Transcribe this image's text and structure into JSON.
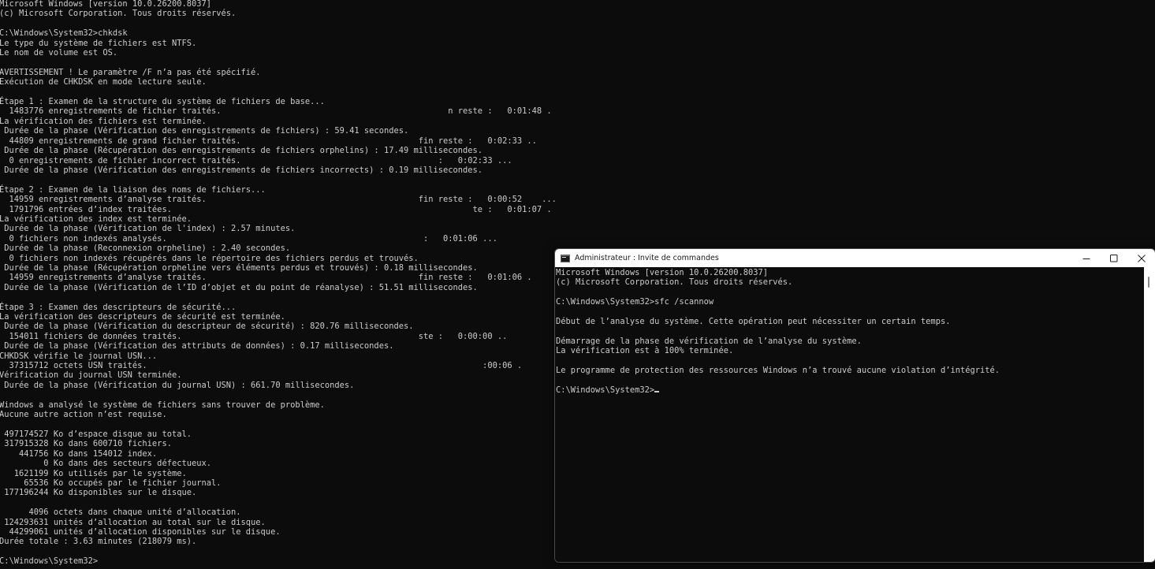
{
  "background_console": {
    "lines": [
      "Microsoft Windows [version 10.0.26200.8037]",
      "(c) Microsoft Corporation. Tous droits réservés.",
      "",
      "C:\\Windows\\System32>chkdsk",
      "Le type du système de fichiers est NTFS.",
      "Le nom de volume est OS.",
      "",
      "AVERTISSEMENT ! Le paramètre /F n’a pas été spécifié.",
      "Exécution de CHKDSK en mode lecture seule.",
      "",
      "Étape 1 : Examen de la structure du système de fichiers de base...",
      "  1483776 enregistrements de fichier traités.                                              n reste :   0:01:48 .",
      "La vérification des fichiers est terminée.",
      " Durée de la phase (Vérification des enregistrements de fichiers) : 59.41 secondes.",
      "  44809 enregistrements de grand fichier traités.                                    fin reste :   0:02:33 ..",
      " Durée de la phase (Récupération des enregistrements de fichiers orphelins) : 17.49 millisecondes.",
      "  0 enregistrements de fichier incorrect traités.                                        :   0:02:33 ...",
      " Durée de la phase (Vérification des enregistrements de fichiers incorrects) : 0.19 millisecondes.",
      "",
      "Étape 2 : Examen de la liaison des noms de fichiers...",
      "  14959 enregistrements d’analyse traités.                                           fin reste :   0:00:52    ...",
      "  1791796 entrées d’index traitées.                                                             te :   0:01:07 .",
      "La vérification des index est terminée.",
      " Durée de la phase (Vérification de l'index) : 2.57 minutes.",
      "  0 fichiers non indexés analysés.                                                    :   0:01:06 ...",
      " Durée de la phase (Reconnexion orpheline) : 2.40 secondes.",
      "  0 fichiers non indexés récupérés dans le répertoire des fichiers perdus et trouvés.",
      " Durée de la phase (Récupération orpheline vers éléments perdus et trouvés) : 0.18 millisecondes.",
      "  14959 enregistrements d’analyse traités.                                           fin reste :   0:01:06 .",
      " Durée de la phase (Vérification de l’ID d’objet et du point de réanalyse) : 51.51 millisecondes.",
      "",
      "Étape 3 : Examen des descripteurs de sécurité...",
      "La vérification des descripteurs de sécurité est terminée.",
      " Durée de la phase (Vérification du descripteur de sécurité) : 820.76 millisecondes.",
      "  154011 fichiers de données traités.                                                ste :   0:00:00 ..",
      " Durée de la phase (Vérification des attributs de données) : 0.17 millisecondes.",
      "CHKDSK vérifie le journal USN...",
      "  37315712 octets USN traités.                                                                    :00:06 .",
      "Vérification du journal USN terminée.",
      " Durée de la phase (Vérification du journal USN) : 661.70 millisecondes.",
      "",
      "Windows a analysé le système de fichiers sans trouver de problème.",
      "Aucune autre action n’est requise.",
      "",
      " 497174527 Ko d’espace disque au total.",
      " 317915328 Ko dans 600710 fichiers.",
      "    441756 Ko dans 154012 index.",
      "         0 Ko dans des secteurs défectueux.",
      "   1621199 Ko utilisés par le système.",
      "     65536 Ko occupés par le fichier journal.",
      " 177196244 Ko disponibles sur le disque.",
      "",
      "      4096 octets dans chaque unité d’allocation.",
      " 124293631 unités d’allocation au total sur le disque.",
      "  44299061 unités d’allocation disponibles sur le disque.",
      "Durée totale : 3.63 minutes (218079 ms).",
      "",
      "C:\\Windows\\System32>"
    ]
  },
  "foreground_window": {
    "title": "Administrateur : Invite de commandes",
    "icon": "cmd-icon",
    "controls": {
      "minimize_icon": "minimize-icon",
      "maximize_icon": "maximize-icon",
      "close_icon": "close-icon"
    },
    "lines": [
      "Microsoft Windows [version 10.0.26200.8037]",
      "(c) Microsoft Corporation. Tous droits réservés.",
      "",
      "C:\\Windows\\System32>sfc /scannow",
      "",
      "Début de l’analyse du système. Cette opération peut nécessiter un certain temps.",
      "",
      "Démarrage de la phase de vérification de l’analyse du système.",
      "La vérification est à 100% terminée.",
      "",
      "Le programme de protection des ressources Windows n’a trouvé aucune violation d’intégrité.",
      "",
      "C:\\Windows\\System32>"
    ]
  },
  "colors": {
    "console_background": "#0c0c0c",
    "console_text": "#cccccc",
    "titlebar_background": "#ffffff"
  }
}
